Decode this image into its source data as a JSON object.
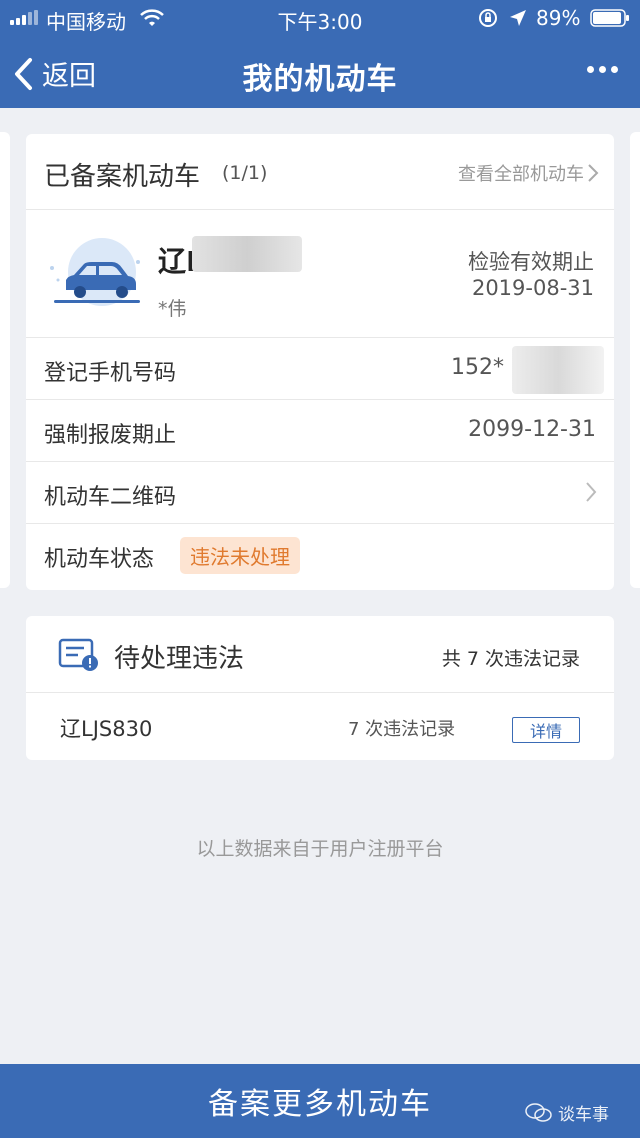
{
  "status_bar": {
    "carrier": "中国移动",
    "time": "下午3:00",
    "battery": "89%"
  },
  "nav": {
    "back_label": "返回",
    "title": "我的机动车"
  },
  "vehicle_card": {
    "title": "已备案机动车",
    "count": "(1/1)",
    "view_all": "查看全部机动车",
    "plate_prefix": "辽L",
    "owner": "*伟",
    "inspection_label": "检验有效期止",
    "inspection_date": "2019-08-31",
    "rows": [
      {
        "label": "登记手机号码",
        "value": "152*"
      },
      {
        "label": "强制报废期止",
        "value": "2099-12-31"
      },
      {
        "label": "机动车二维码",
        "value": ""
      },
      {
        "label": "机动车状态",
        "badge": "违法未处理"
      }
    ]
  },
  "violations": {
    "title": "待处理违法",
    "total": "共 7 次违法记录",
    "items": [
      {
        "plate": "辽LJS830",
        "count": "7 次违法记录",
        "action": "详情"
      }
    ]
  },
  "footnote": "以上数据来自于用户注册平台",
  "bottom_button": "备案更多机动车",
  "watermark": "谈车事",
  "colors": {
    "primary": "#3a6bb5",
    "badge_bg": "#fde4d2",
    "badge_text": "#e07a2f"
  }
}
